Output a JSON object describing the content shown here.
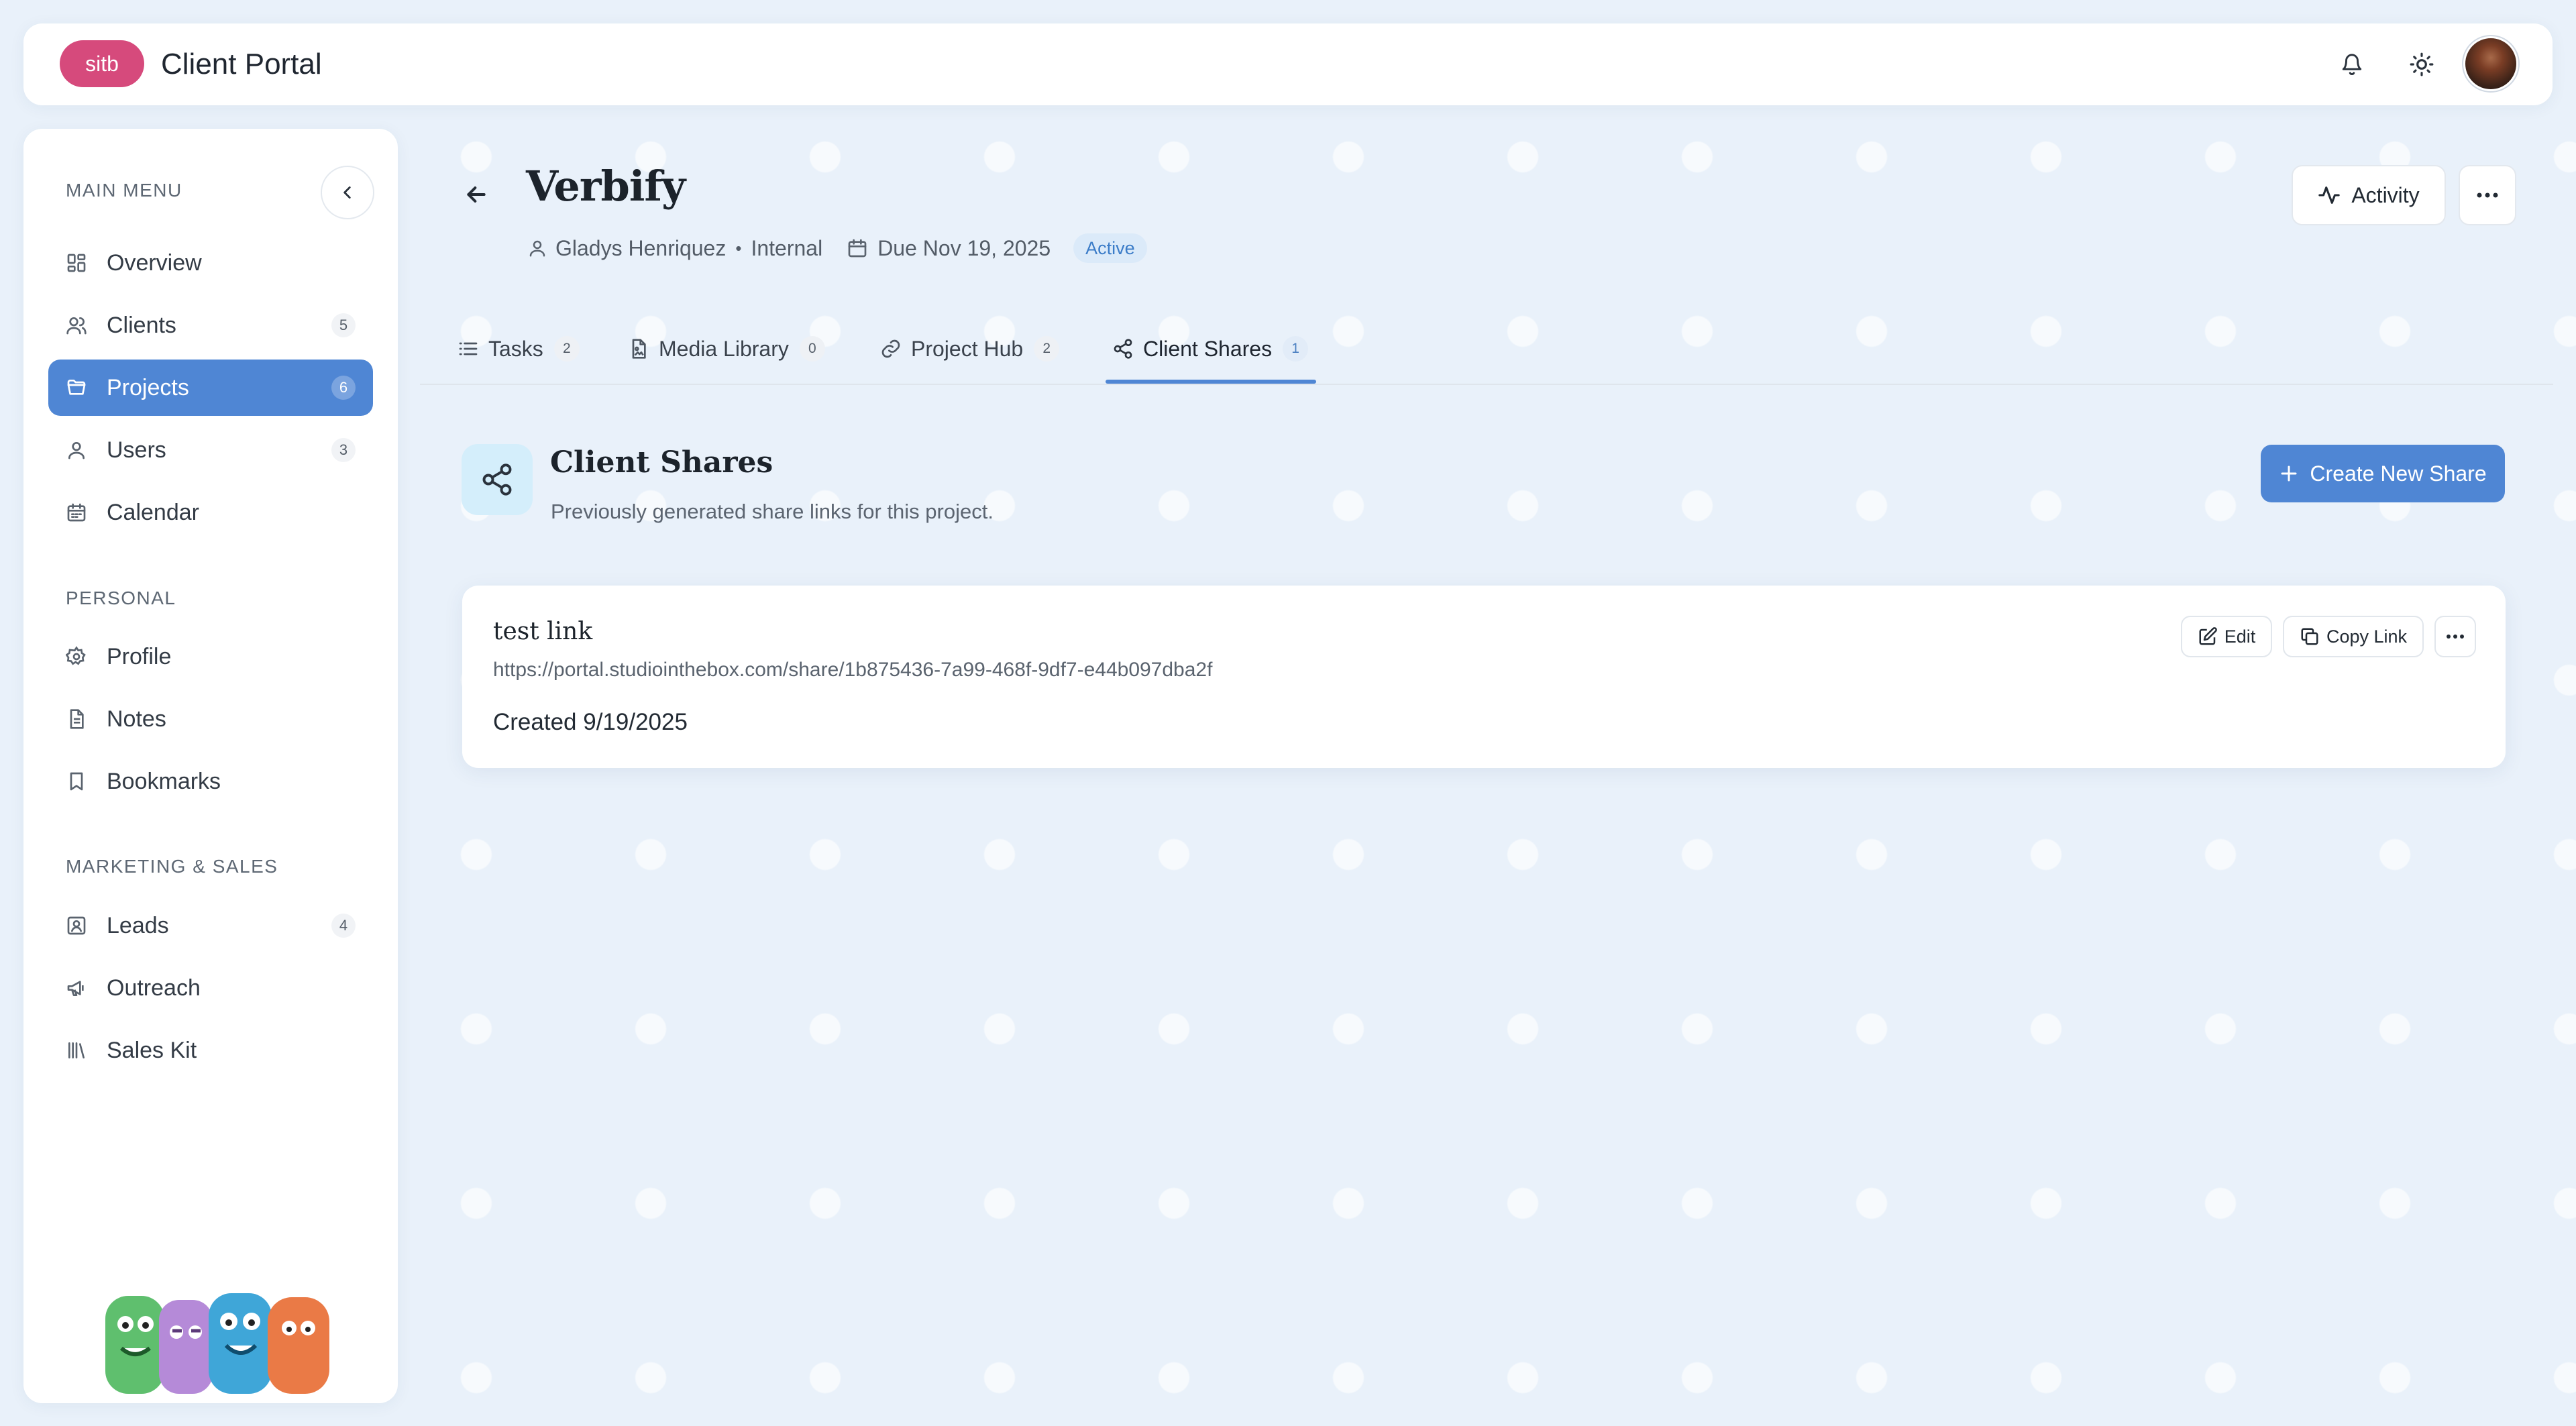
{
  "app": {
    "brand_short": "sitb",
    "title": "Client Portal",
    "colors": {
      "accent": "#4f86d4",
      "brand": "#d64a7c",
      "status_active": "#3b7cc8"
    }
  },
  "topbar": {
    "icons": [
      "bell-icon",
      "sun-icon"
    ],
    "avatar": "user-avatar"
  },
  "sidebar": {
    "sections": {
      "main": "MAIN MENU",
      "personal": "PERSONAL",
      "marketing": "MARKETING & SALES"
    },
    "main_items": [
      {
        "label": "Overview",
        "icon": "grid-icon"
      },
      {
        "label": "Clients",
        "icon": "users-icon",
        "badge": "5"
      },
      {
        "label": "Projects",
        "icon": "folder-icon",
        "badge": "6",
        "active": true
      },
      {
        "label": "Users",
        "icon": "user-icon",
        "badge": "3"
      },
      {
        "label": "Calendar",
        "icon": "calendar-icon"
      }
    ],
    "personal_items": [
      {
        "label": "Profile",
        "icon": "gear-icon"
      },
      {
        "label": "Notes",
        "icon": "document-icon"
      },
      {
        "label": "Bookmarks",
        "icon": "bookmark-icon"
      }
    ],
    "marketing_items": [
      {
        "label": "Leads",
        "icon": "contact-icon",
        "badge": "4"
      },
      {
        "label": "Outreach",
        "icon": "megaphone-icon"
      },
      {
        "label": "Sales Kit",
        "icon": "library-icon"
      }
    ]
  },
  "project": {
    "title": "Verbify",
    "owner": "Gladys Henriquez",
    "type": "Internal",
    "due": "Due Nov 19, 2025",
    "status": "Active",
    "activity_label": "Activity"
  },
  "tabs": [
    {
      "label": "Tasks",
      "count": "2"
    },
    {
      "label": "Media Library",
      "count": "0"
    },
    {
      "label": "Project Hub",
      "count": "2"
    },
    {
      "label": "Client Shares",
      "count": "1",
      "active": true
    }
  ],
  "shares_section": {
    "heading": "Client Shares",
    "subtitle": "Previously generated share links for this project.",
    "create_label": "Create New Share"
  },
  "shares": [
    {
      "name": "test link",
      "url": "https://portal.studiointhebox.com/share/1b875436-7a99-468f-9df7-e44b097dba2f",
      "created": "Created 9/19/2025",
      "edit_label": "Edit",
      "copy_label": "Copy Link"
    }
  ]
}
